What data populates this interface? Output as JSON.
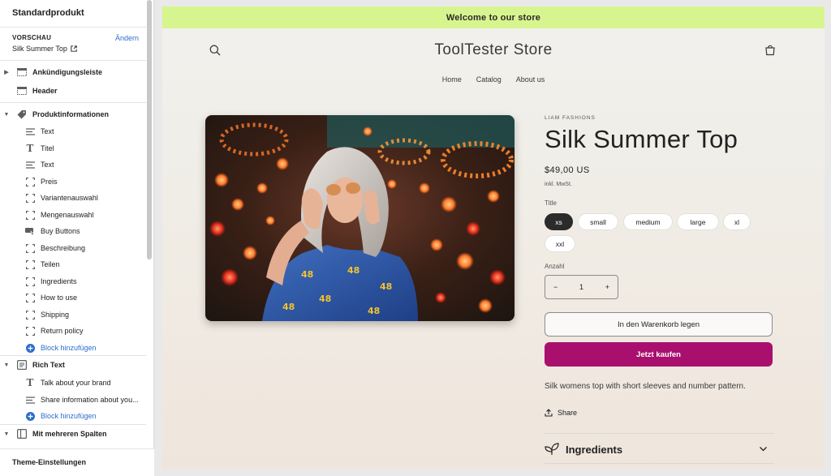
{
  "sidebar": {
    "title": "Standardprodukt",
    "preview_label": "VORSCHAU",
    "preview_change": "Ändern",
    "preview_value": "Silk Summer Top",
    "sections": [
      {
        "label": "Ankündigungsleiste"
      },
      {
        "label": "Header"
      },
      {
        "label": "Produktinformationen"
      },
      {
        "label": "Rich Text"
      },
      {
        "label": "Mit mehreren Spalten"
      }
    ],
    "product_blocks": [
      {
        "label": "Text"
      },
      {
        "label": "Titel"
      },
      {
        "label": "Text"
      },
      {
        "label": "Preis"
      },
      {
        "label": "Variantenauswahl"
      },
      {
        "label": "Mengenauswahl"
      },
      {
        "label": "Buy Buttons"
      },
      {
        "label": "Beschreibung"
      },
      {
        "label": "Teilen"
      },
      {
        "label": "Ingredients"
      },
      {
        "label": "How to use"
      },
      {
        "label": "Shipping"
      },
      {
        "label": "Return policy"
      }
    ],
    "add_block": "Block hinzufügen",
    "richtext_blocks": [
      {
        "label": "Talk about your brand"
      },
      {
        "label": "Share information about you..."
      }
    ],
    "theme_settings": "Theme-Einstellungen"
  },
  "store": {
    "announcement": "Welcome to our store",
    "name": "ToolTester Store",
    "nav": [
      "Home",
      "Catalog",
      "About us"
    ],
    "vendor": "LIAM FASHIONS",
    "product_title": "Silk Summer Top",
    "price": "$49,00 US",
    "tax_note": "inkl. MwSt.",
    "option_label": "Title",
    "options": [
      "xs",
      "small",
      "medium",
      "large",
      "xl",
      "xxl"
    ],
    "selected_option": "xs",
    "quantity_label": "Anzahl",
    "quantity": "1",
    "qty_minus": "−",
    "qty_plus": "+",
    "add_to_cart": "In den Warenkorb legen",
    "buy_now": "Jetzt kaufen",
    "description": "Silk womens top with short sleeves and number pattern.",
    "share": "Share",
    "accordion": "Ingredients"
  },
  "colors": {
    "announcement_bg": "#d7f58f",
    "buy_button": "#a9106e",
    "selected_pill": "#2b2b2b",
    "link": "#2c6ecb"
  },
  "icons": [
    "search-icon",
    "cart-icon",
    "external-link-icon",
    "tag-icon",
    "share-icon",
    "leaf-icon",
    "chevron-down-icon",
    "plus-circle-icon"
  ]
}
